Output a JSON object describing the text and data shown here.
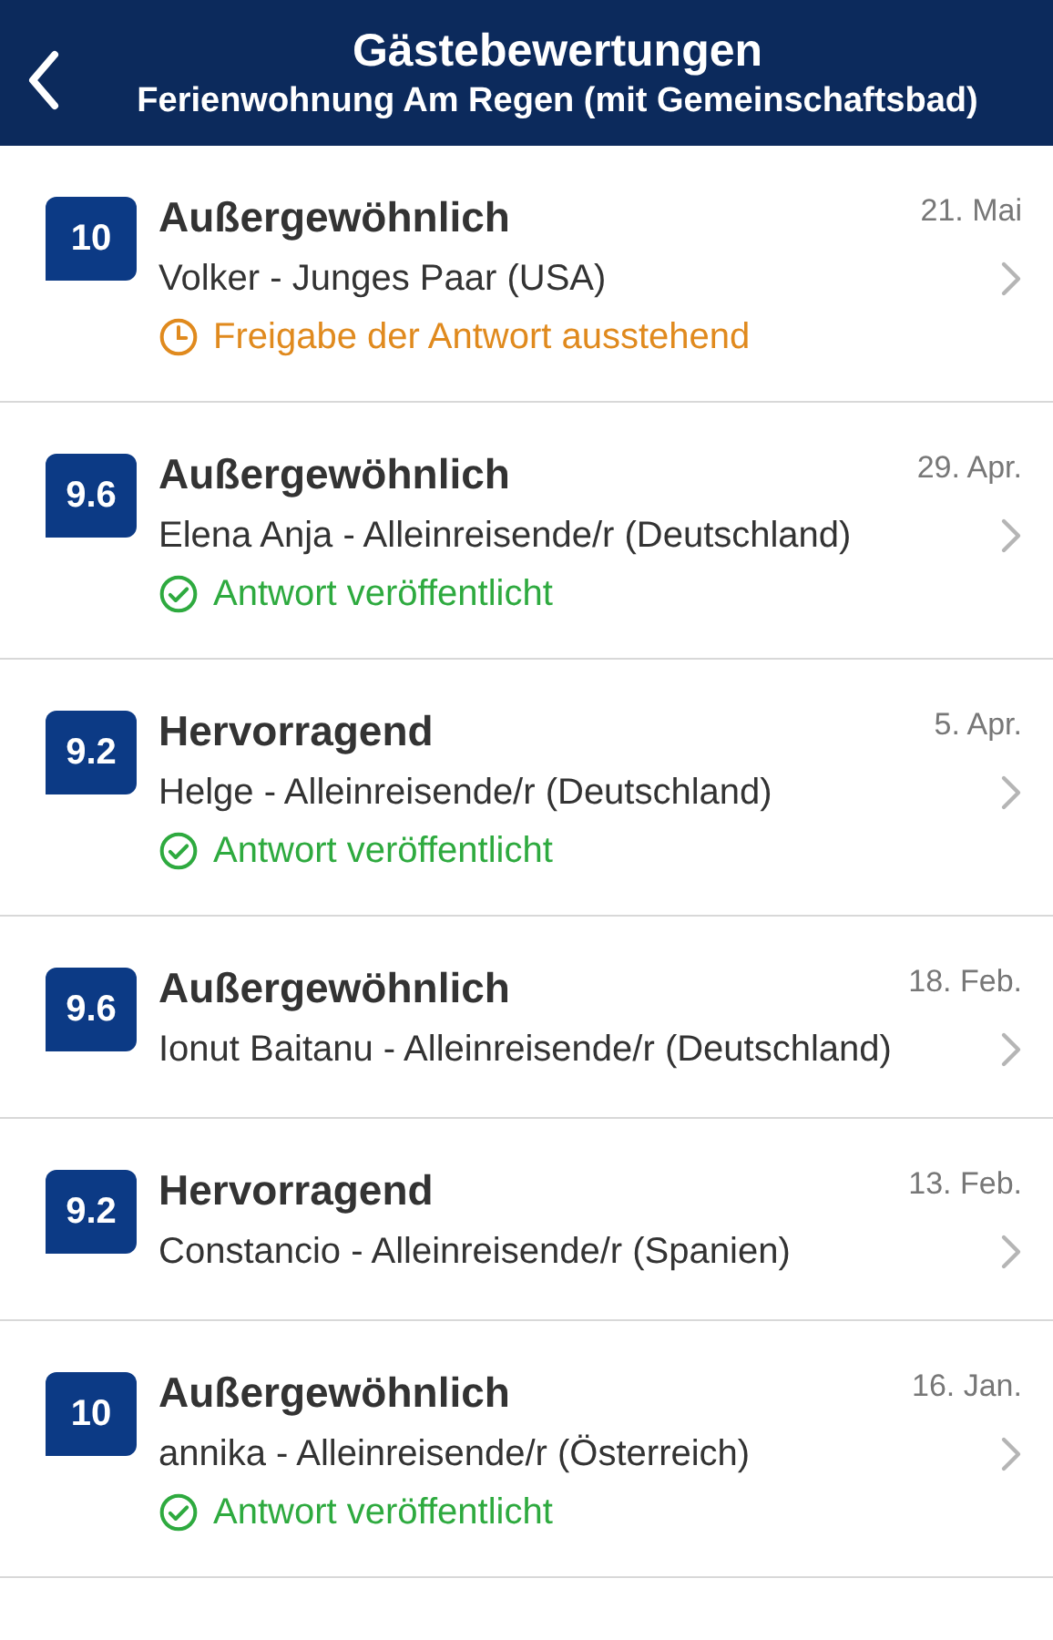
{
  "header": {
    "title": "Gästebewertungen",
    "subtitle": "Ferienwohnung Am Regen (mit Gemeinschaftsbad)"
  },
  "reviews": [
    {
      "score": "10",
      "rating": "Außergewöhnlich",
      "date": "21. Mai",
      "guest": "Volker - Junges Paar (USA)",
      "status": {
        "kind": "pending",
        "text": "Freigabe der Antwort ausstehend"
      }
    },
    {
      "score": "9.6",
      "rating": "Außergewöhnlich",
      "date": "29. Apr.",
      "guest": "Elena Anja - Alleinreisende/r (Deutschland)",
      "status": {
        "kind": "published",
        "text": "Antwort veröffentlicht"
      }
    },
    {
      "score": "9.2",
      "rating": "Hervorragend",
      "date": "5. Apr.",
      "guest": "Helge - Alleinreisende/r (Deutschland)",
      "status": {
        "kind": "published",
        "text": "Antwort veröffentlicht"
      }
    },
    {
      "score": "9.6",
      "rating": "Außergewöhnlich",
      "date": "18. Feb.",
      "guest": "Ionut Baitanu - Alleinreisende/r (Deutschland)"
    },
    {
      "score": "9.2",
      "rating": "Hervorragend",
      "date": "13. Feb.",
      "guest": "Constancio - Alleinreisende/r (Spanien)"
    },
    {
      "score": "10",
      "rating": "Außergewöhnlich",
      "date": "16. Jan.",
      "guest": "annika - Alleinreisende/r (Österreich)",
      "status": {
        "kind": "published",
        "text": "Antwort veröffentlicht"
      }
    }
  ]
}
